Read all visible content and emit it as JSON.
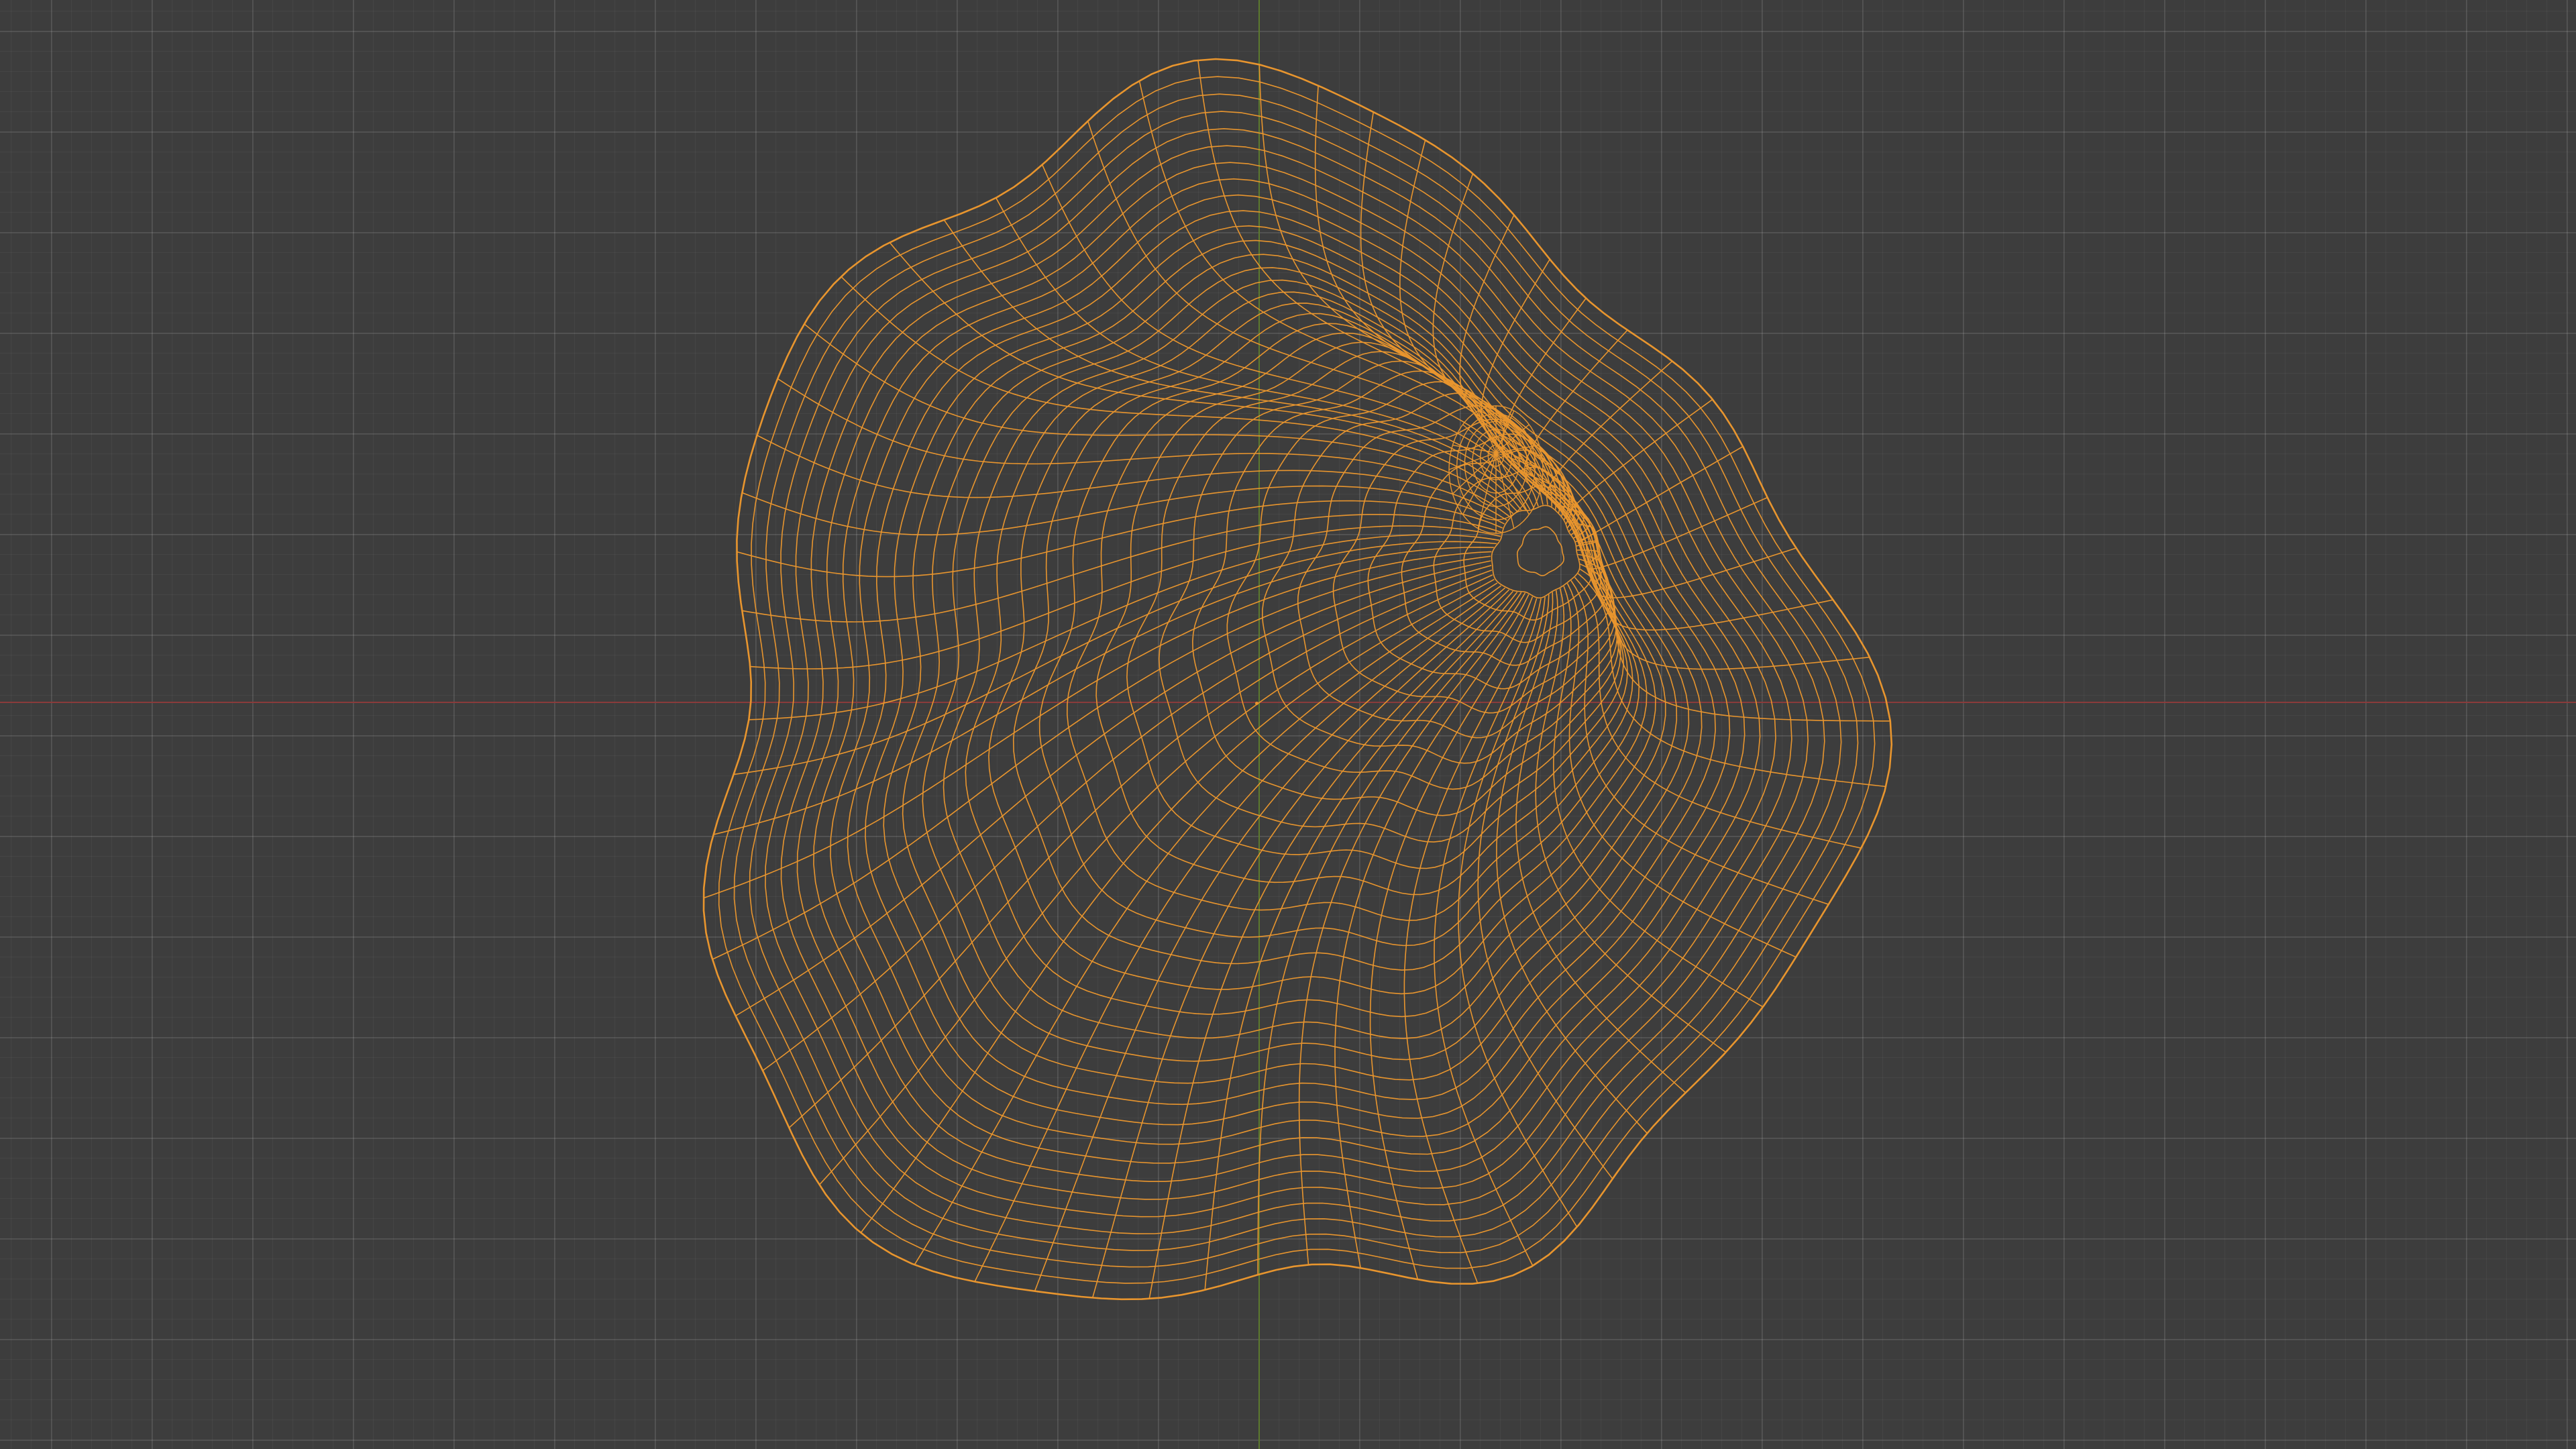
{
  "viewport": {
    "background_color": "#3d3d3d",
    "axis_x_color": "#8a3b3b",
    "axis_y_color": "#5c7a2e",
    "wire_color": "#e8952e",
    "wire_outline_color": "#f0a040",
    "object": "wireframe-mesh"
  }
}
